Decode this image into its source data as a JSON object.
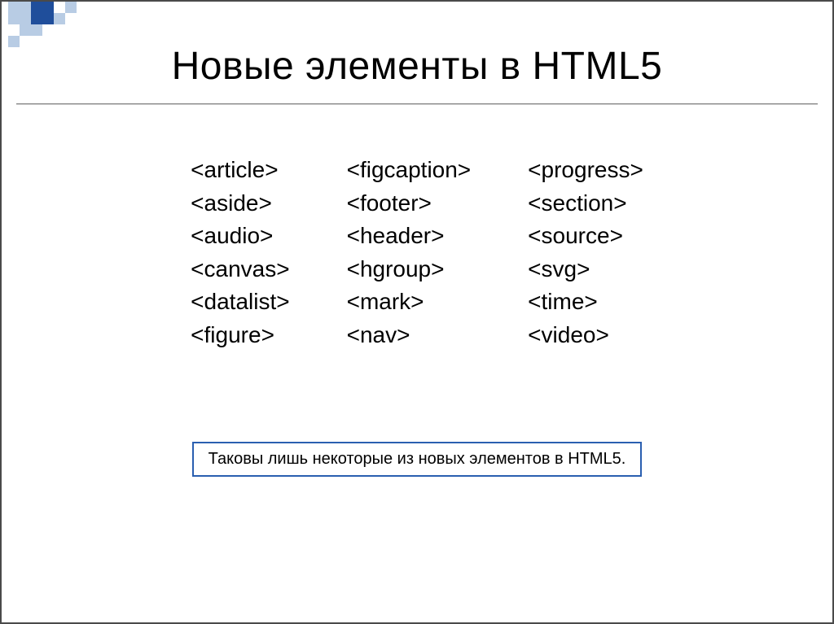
{
  "title": "Новые элементы в HTML5",
  "columns": [
    [
      "<article>",
      "<aside>",
      "<audio>",
      "<canvas>",
      "<datalist>",
      "<figure>"
    ],
    [
      "<figcaption>",
      "<footer>",
      "<header>",
      "<hgroup>",
      "<mark>",
      "<nav>"
    ],
    [
      "<progress>",
      "<section>",
      "<source>",
      "<svg>",
      "<time>",
      "<video>"
    ]
  ],
  "note": "Таковы лишь некоторые из новых элементов в HTML5.",
  "colors": {
    "deco_dark": "#1f4e9b",
    "deco_light": "#b8cce4"
  }
}
